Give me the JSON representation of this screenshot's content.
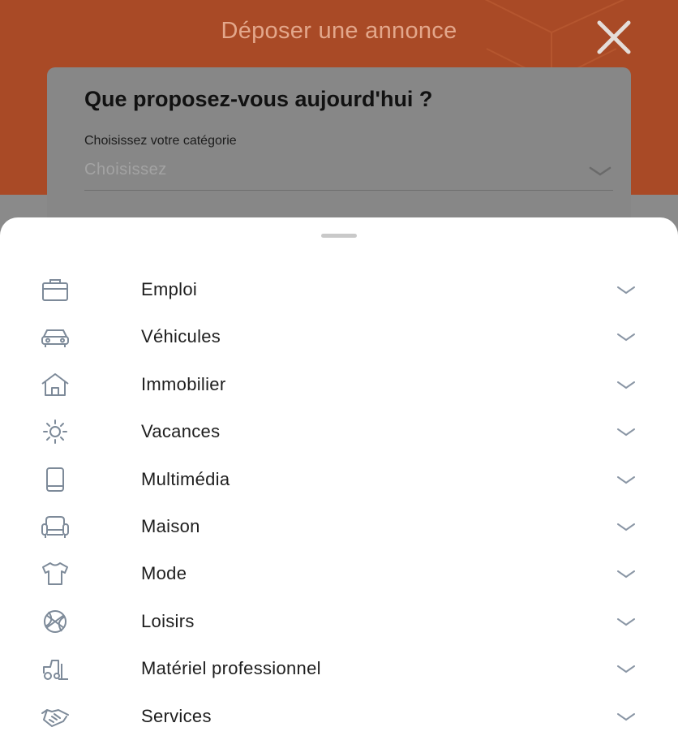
{
  "header": {
    "title": "Déposer une annonce",
    "close_icon": "close-icon",
    "accent_color": "#a94a26"
  },
  "form": {
    "title": "Que proposez-vous aujourd'hui ?",
    "category_label": "Choisissez votre catégorie",
    "category_placeholder": "Choisissez"
  },
  "sheet": {
    "categories": [
      {
        "label": "Emploi",
        "icon": "briefcase-icon"
      },
      {
        "label": "Véhicules",
        "icon": "car-icon"
      },
      {
        "label": "Immobilier",
        "icon": "house-icon"
      },
      {
        "label": "Vacances",
        "icon": "sun-icon"
      },
      {
        "label": "Multimédia",
        "icon": "tablet-icon"
      },
      {
        "label": "Maison",
        "icon": "armchair-icon"
      },
      {
        "label": "Mode",
        "icon": "tshirt-icon"
      },
      {
        "label": "Loisirs",
        "icon": "ball-icon"
      },
      {
        "label": "Matériel professionnel",
        "icon": "tractor-icon"
      },
      {
        "label": "Services",
        "icon": "handshake-icon"
      }
    ]
  }
}
